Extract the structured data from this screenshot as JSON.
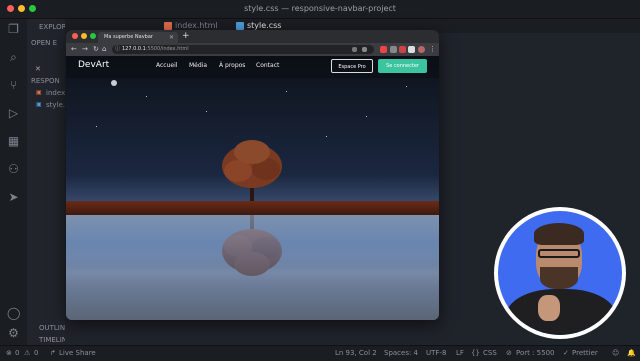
{
  "window": {
    "title": "style.css — responsive-navbar-project"
  },
  "editor_tabs": [
    {
      "label": "index.html",
      "icon": "html-icon"
    },
    {
      "label": "style.css",
      "icon": "css-icon"
    }
  ],
  "sidebar": {
    "explorer_label": "EXPLORER",
    "open_editors_label": "OPEN E",
    "project_label": "RESPON",
    "files": [
      "index",
      "style."
    ],
    "outline_label": "OUTLINE",
    "timeline_label": "TIMELINE"
  },
  "browser": {
    "tab_title": "Ma superbe Navbar",
    "url_host": "127.0.0.1",
    "url_rest": ":5500/index.html"
  },
  "page": {
    "logo": "DevArt",
    "nav_links": [
      "Accueil",
      "Média",
      "À propos",
      "Contact"
    ],
    "btn_pro": "Espace Pro",
    "btn_login": "Se connecter"
  },
  "status": {
    "errors": "0",
    "warnings": "0",
    "live_share": "Live Share",
    "position": "Ln 93, Col 2",
    "spaces": "Spaces: 4",
    "encoding": "UTF-8",
    "eol": "LF",
    "language": "CSS",
    "port": "Port : 5500",
    "prettier": "Prettier"
  },
  "colors": {
    "accent_button": "#3bc4a0",
    "webcam_bg": "#3f6bf0"
  }
}
